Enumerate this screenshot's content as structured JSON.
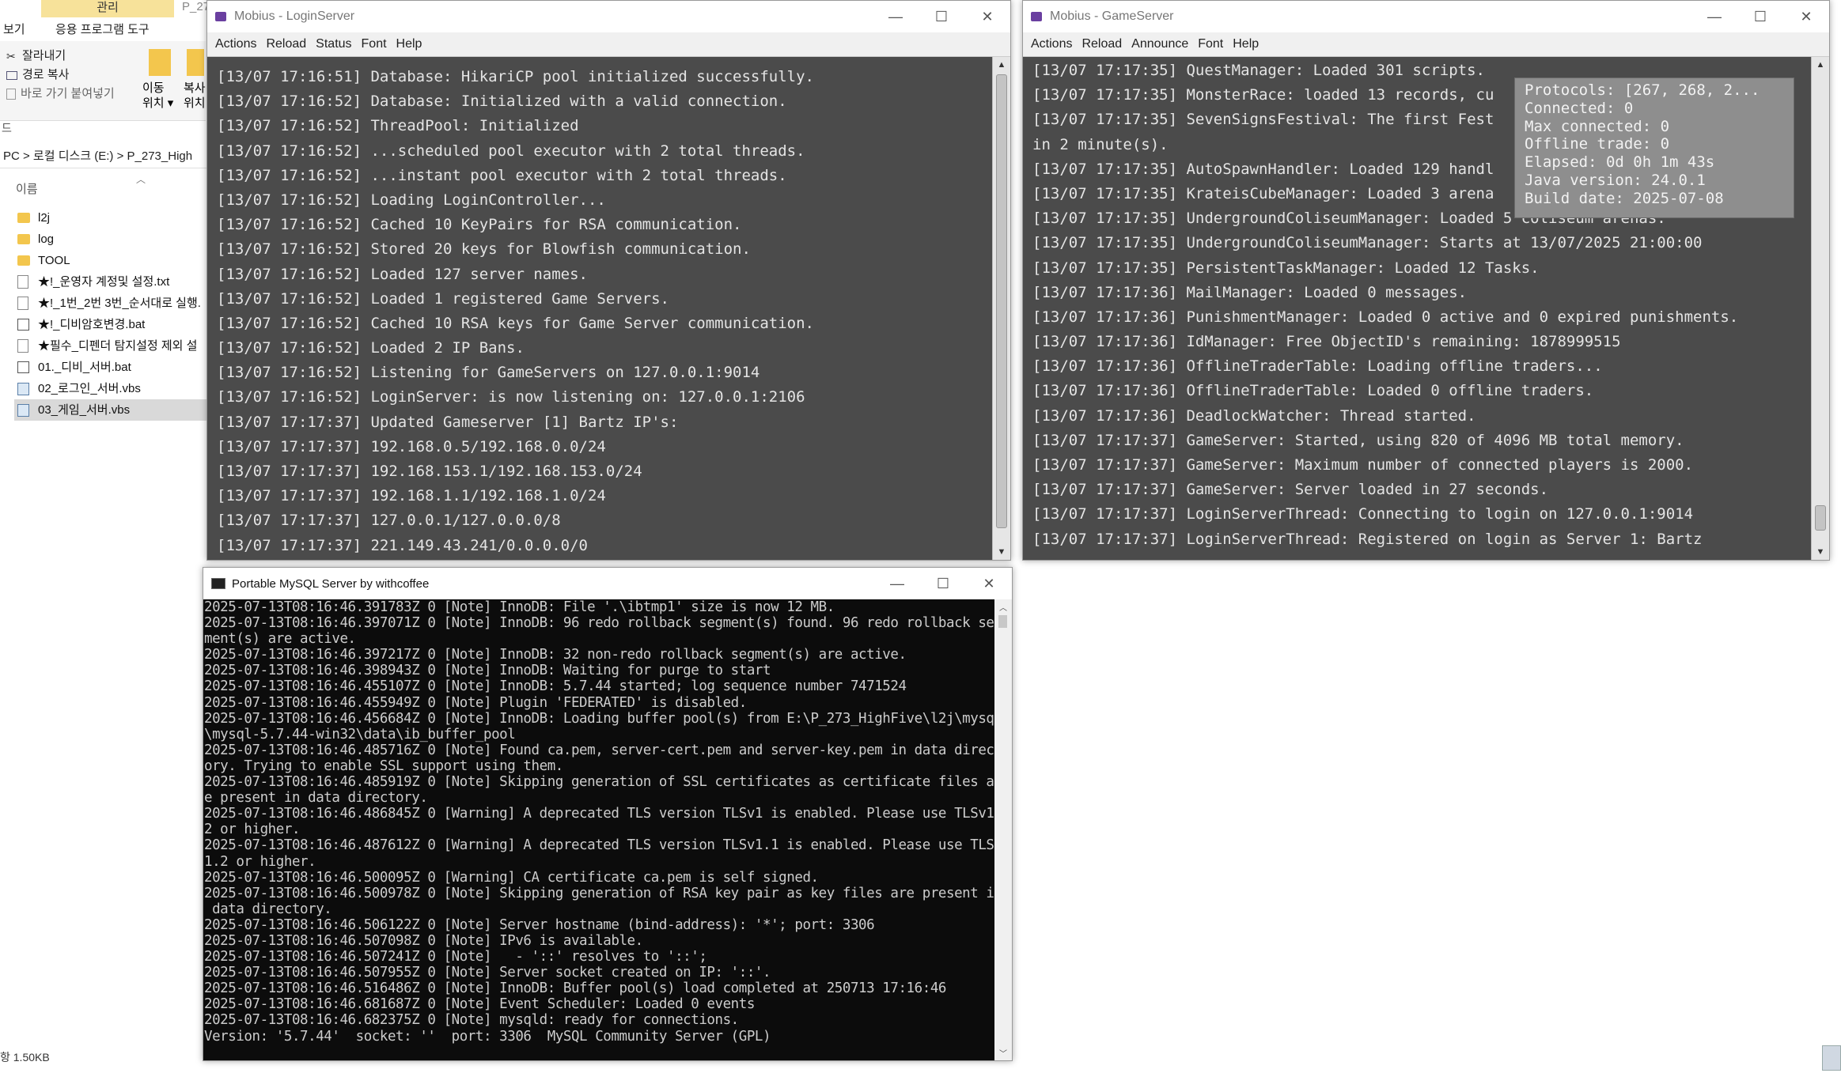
{
  "explorer": {
    "ribbon": {
      "manage_tab": "관리",
      "partial_tab": "P_27",
      "view_tab": "보기",
      "app_tools_tab": "응용 프로그램 도구",
      "cut": "잘라내기",
      "copy_path": "경로 복사",
      "paste_shortcut": "바로 가기 붙여넣기",
      "move_to": "이동\n위치 ▾",
      "copy_to": "복사\n위치",
      "section_label": "드"
    },
    "address": "PC  >  로컬 디스크 (E:)  >  P_273_High",
    "column_header": "이름",
    "files": [
      {
        "name": "l2j",
        "type": "folder"
      },
      {
        "name": "log",
        "type": "folder"
      },
      {
        "name": "TOOL",
        "type": "folder"
      },
      {
        "name": "★!_운영자 계정및 설정.txt",
        "type": "doc"
      },
      {
        "name": "★!_1번_2번 3번_순서대로 실행.",
        "type": "doc"
      },
      {
        "name": "★!_디비암호변경.bat",
        "type": "bat"
      },
      {
        "name": "★필수_디펜더 탐지설정 제외 설",
        "type": "doc"
      },
      {
        "name": "01._디비_서버.bat",
        "type": "bat"
      },
      {
        "name": "02_로그인_서버.vbs",
        "type": "vbs"
      },
      {
        "name": "03_게임_서버.vbs",
        "type": "vbs",
        "selected": true
      }
    ],
    "status": "항 1.50KB"
  },
  "login_window": {
    "title": "Mobius - LoginServer",
    "menu": [
      "Actions",
      "Reload",
      "Status",
      "Font",
      "Help"
    ],
    "lines": [
      "[13/07 17:16:51] Database: HikariCP pool initialized successfully.",
      "[13/07 17:16:52] Database: Initialized with a valid connection.",
      "[13/07 17:16:52] ThreadPool: Initialized",
      "[13/07 17:16:52] ...scheduled pool executor with 2 total threads.",
      "[13/07 17:16:52] ...instant pool executor with 2 total threads.",
      "[13/07 17:16:52] Loading LoginController...",
      "[13/07 17:16:52] Cached 10 KeyPairs for RSA communication.",
      "[13/07 17:16:52] Stored 20 keys for Blowfish communication.",
      "[13/07 17:16:52] Loaded 127 server names.",
      "[13/07 17:16:52] Loaded 1 registered Game Servers.",
      "[13/07 17:16:52] Cached 10 RSA keys for Game Server communication.",
      "[13/07 17:16:52] Loaded 2 IP Bans.",
      "[13/07 17:16:52] Listening for GameServers on 127.0.0.1:9014",
      "[13/07 17:16:52] LoginServer: is now listening on: 127.0.0.1:2106",
      "[13/07 17:17:37] Updated Gameserver [1] Bartz IP's:",
      "[13/07 17:17:37] 192.168.0.5/192.168.0.0/24",
      "[13/07 17:17:37] 192.168.153.1/192.168.153.0/24",
      "[13/07 17:17:37] 192.168.1.1/192.168.1.0/24",
      "[13/07 17:17:37] 127.0.0.1/127.0.0.0/8",
      "[13/07 17:17:37] 221.149.43.241/0.0.0.0/0"
    ]
  },
  "game_window": {
    "title": "Mobius - GameServer",
    "menu": [
      "Actions",
      "Reload",
      "Announce",
      "Font",
      "Help"
    ],
    "lines": [
      "[13/07 17:17:35] QuestManager: Loaded 301 scripts.",
      "[13/07 17:17:35] MonsterRace: loaded 13 records, cu",
      "[13/07 17:17:35] SevenSignsFestival: The first Fest",
      "in 2 minute(s).",
      "[13/07 17:17:35] AutoSpawnHandler: Loaded 129 handl",
      "[13/07 17:17:35] KrateisCubeManager: Loaded 3 arena",
      "[13/07 17:17:35] UndergroundColiseumManager: Loaded 5 coliseum arenas.",
      "[13/07 17:17:35] UndergroundColiseumManager: Starts at 13/07/2025 21:00:00",
      "[13/07 17:17:35] PersistentTaskManager: Loaded 12 Tasks.",
      "[13/07 17:17:36] MailManager: Loaded 0 messages.",
      "[13/07 17:17:36] PunishmentManager: Loaded 0 active and 0 expired punishments.",
      "[13/07 17:17:36] IdManager: Free ObjectID's remaining: 1878999515",
      "[13/07 17:17:36] OfflineTraderTable: Loading offline traders...",
      "[13/07 17:17:36] OfflineTraderTable: Loaded 0 offline traders.",
      "[13/07 17:17:36] DeadlockWatcher: Thread started.",
      "[13/07 17:17:37] GameServer: Started, using 820 of 4096 MB total memory.",
      "[13/07 17:17:37] GameServer: Maximum number of connected players is 2000.",
      "[13/07 17:17:37] GameServer: Server loaded in 27 seconds.",
      "[13/07 17:17:37] LoginServerThread: Connecting to login on 127.0.0.1:9014",
      "[13/07 17:17:37] LoginServerThread: Registered on login as Server 1: Bartz"
    ],
    "status_box": [
      "Protocols: [267, 268, 2...",
      "Connected: 0",
      "Max connected: 0",
      "Offline trade: 0",
      "Elapsed: 0d 0h 1m 43s",
      "Java version: 24.0.1",
      "Build date: 2025-07-08"
    ]
  },
  "mysql_window": {
    "title": "Portable MySQL Server by withcoffee",
    "lines": [
      "2025-07-13T08:16:46.391783Z 0 [Note] InnoDB: File '.\\ibtmp1' size is now 12 MB.",
      "2025-07-13T08:16:46.397071Z 0 [Note] InnoDB: 96 redo rollback segment(s) found. 96 redo rollback seg",
      "ment(s) are active.",
      "2025-07-13T08:16:46.397217Z 0 [Note] InnoDB: 32 non-redo rollback segment(s) are active.",
      "2025-07-13T08:16:46.398943Z 0 [Note] InnoDB: Waiting for purge to start",
      "2025-07-13T08:16:46.455107Z 0 [Note] InnoDB: 5.7.44 started; log sequence number 7471524",
      "2025-07-13T08:16:46.455949Z 0 [Note] Plugin 'FEDERATED' is disabled.",
      "2025-07-13T08:16:46.456684Z 0 [Note] InnoDB: Loading buffer pool(s) from E:\\P_273_HighFive\\l2j\\mysql",
      "\\mysql-5.7.44-win32\\data\\ib_buffer_pool",
      "2025-07-13T08:16:46.485716Z 0 [Note] Found ca.pem, server-cert.pem and server-key.pem in data direct",
      "ory. Trying to enable SSL support using them.",
      "2025-07-13T08:16:46.485919Z 0 [Note] Skipping generation of SSL certificates as certificate files ar",
      "e present in data directory.",
      "2025-07-13T08:16:46.486845Z 0 [Warning] A deprecated TLS version TLSv1 is enabled. Please use TLSv1.",
      "2 or higher.",
      "2025-07-13T08:16:46.487612Z 0 [Warning] A deprecated TLS version TLSv1.1 is enabled. Please use TLSv",
      "1.2 or higher.",
      "2025-07-13T08:16:46.500095Z 0 [Warning] CA certificate ca.pem is self signed.",
      "2025-07-13T08:16:46.500978Z 0 [Note] Skipping generation of RSA key pair as key files are present in",
      " data directory.",
      "2025-07-13T08:16:46.506122Z 0 [Note] Server hostname (bind-address): '*'; port: 3306",
      "2025-07-13T08:16:46.507098Z 0 [Note] IPv6 is available.",
      "2025-07-13T08:16:46.507241Z 0 [Note]   - '::' resolves to '::';",
      "2025-07-13T08:16:46.507955Z 0 [Note] Server socket created on IP: '::'.",
      "2025-07-13T08:16:46.516486Z 0 [Note] InnoDB: Buffer pool(s) load completed at 250713 17:16:46",
      "2025-07-13T08:16:46.681687Z 0 [Note] Event Scheduler: Loaded 0 events",
      "2025-07-13T08:16:46.682375Z 0 [Note] mysqld: ready for connections.",
      "Version: '5.7.44'  socket: ''  port: 3306  MySQL Community Server (GPL)"
    ]
  },
  "window_controls": {
    "minimize": "—",
    "maximize": "☐",
    "close": "✕"
  }
}
